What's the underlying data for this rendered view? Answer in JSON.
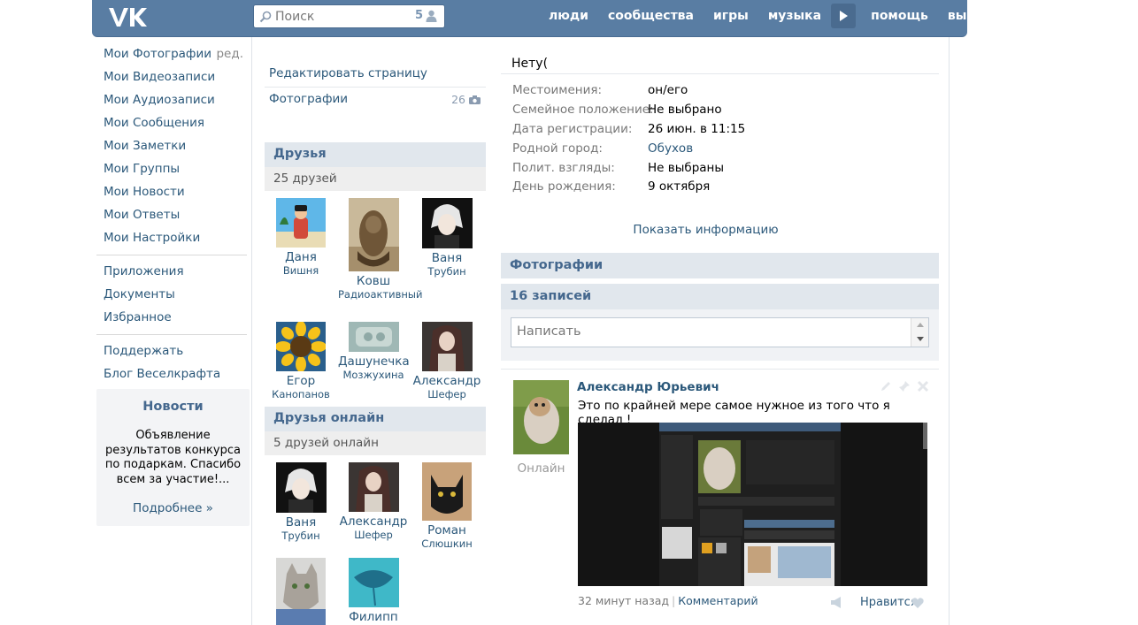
{
  "header": {
    "logo_text": "VK",
    "search_placeholder": "Поиск",
    "search_count": "5",
    "nav": [
      "люди",
      "сообщества",
      "игры",
      "музыка",
      "помощь",
      "выйти"
    ]
  },
  "left_menu": {
    "edit_label": "ред.",
    "group1": [
      "Мои Фотографии",
      "Мои Видеозаписи",
      "Мои Аудиозаписи",
      "Мои Сообщения",
      "Мои Заметки",
      "Мои Группы",
      "Мои Новости",
      "Мои Ответы",
      "Мои Настройки"
    ],
    "group2": [
      "Приложения",
      "Документы",
      "Избранное"
    ],
    "group3": [
      "Поддержать",
      "Блог Веселкрафта"
    ]
  },
  "news": {
    "title": "Новости",
    "text": "Объявление результатов конкурса по подаркам. Спасибо всем за участие!...",
    "more": "Подробнее »"
  },
  "narrow": {
    "edit_page": "Редактировать страницу",
    "photos_label": "Фотографии",
    "photos_count": "26",
    "friends_title": "Друзья",
    "friends_count": "25 друзей",
    "friends": [
      {
        "first": "Даня",
        "last": "Вишня"
      },
      {
        "first": "Ковш",
        "last": "Радиоактивный"
      },
      {
        "first": "Ваня",
        "last": "Трубин"
      },
      {
        "first": "Егор",
        "last": "Канопанов"
      },
      {
        "first": "Дашунечка",
        "last": "Мозжухина"
      },
      {
        "first": "Александр",
        "last": "Шефер"
      }
    ],
    "online_title": "Друзья онлайн",
    "online_count": "5 друзей онлайн",
    "online": [
      {
        "first": "Ваня",
        "last": "Трубин"
      },
      {
        "first": "Александр",
        "last": "Шефер"
      },
      {
        "first": "Роман",
        "last": "Слюшкин"
      },
      {
        "first": "",
        "last": ""
      },
      {
        "first": "Филипп",
        "last": ""
      }
    ]
  },
  "profile": {
    "status": "Нету(",
    "info": [
      {
        "label": "Местоимения:",
        "value": "он/его",
        "link": false
      },
      {
        "label": "Семейное положение:",
        "value": "Не выбрано",
        "link": false
      },
      {
        "label": "Дата регистрации:",
        "value": "26 июн. в 11:15",
        "link": false
      },
      {
        "label": "Родной город:",
        "value": "Обухов",
        "link": true
      },
      {
        "label": "Полит. взгляды:",
        "value": "Не выбраны",
        "link": false
      },
      {
        "label": "День рождения:",
        "value": "9 октября",
        "link": false
      }
    ],
    "show_info": "Показать информацию",
    "photos_title": "Фотографии",
    "wall_title": "16 записей",
    "composer_placeholder": "Написать"
  },
  "post": {
    "author": "Александр Юрьевич",
    "online": "Онлайн",
    "text": "Это по крайней мере самое нужное из того что я сделал !",
    "time": "32 минут назад",
    "separator": "|",
    "comment": "Комментарий",
    "like": "Нравится"
  },
  "colors": {
    "header": "#597da3",
    "link": "#2b587a",
    "section_bg": "#e1e7ed"
  }
}
